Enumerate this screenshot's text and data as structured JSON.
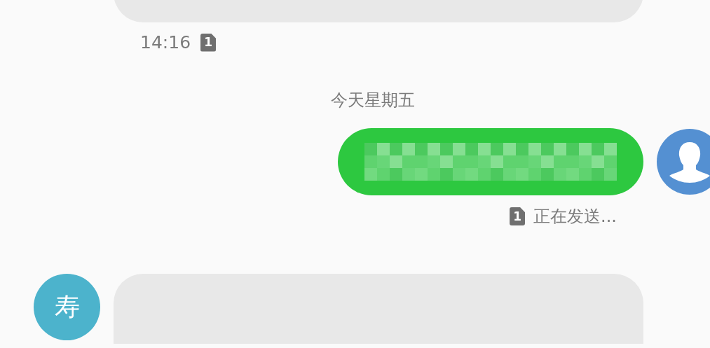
{
  "messages": [
    {
      "kind": "received_cut_top",
      "time": "14:16",
      "sim": "1"
    },
    {
      "kind": "date",
      "label": "今天星期五"
    },
    {
      "kind": "sent_redacted",
      "sim": "1",
      "status": "正在发送..."
    },
    {
      "kind": "received_cut_bottom",
      "avatar": "寿"
    }
  ]
}
